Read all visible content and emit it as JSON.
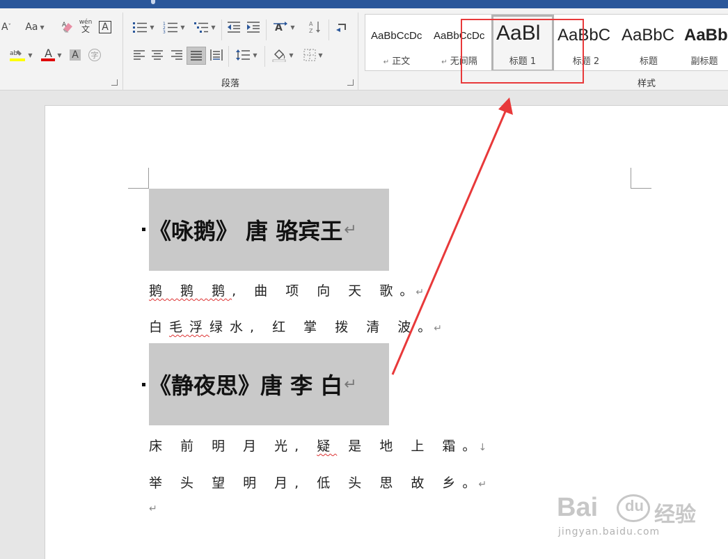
{
  "ribbon": {
    "font_group": {
      "font_shrink_label": "A",
      "change_case_label": "Aa",
      "phonetic_label": "wén\n文",
      "char_border_label": "A",
      "font_color_label": "A",
      "char_shading_label": "A",
      "enclose_char_label": "字",
      "highlight_color": "#ffff00",
      "font_color": "#e00000"
    },
    "paragraph_group": {
      "label": "段落"
    },
    "styles_group": {
      "label": "样式",
      "items": [
        {
          "preview": "AaBbCcDc",
          "name": "正文",
          "mark": "↵"
        },
        {
          "preview": "AaBbCcDc",
          "name": "无间隔",
          "mark": "↵"
        },
        {
          "preview": "AaBl",
          "name": "标题 1"
        },
        {
          "preview": "AaBbC",
          "name": "标题 2"
        },
        {
          "preview": "AaBbC",
          "name": "标题"
        },
        {
          "preview": "AaBb",
          "name": "副标题"
        }
      ]
    }
  },
  "document": {
    "heading1": "《咏鹅》 唐 骆宾王",
    "poem1_line1_prefix": "鹅 鹅 鹅",
    "poem1_line1_rest": ", 曲 项 向 天 歌。",
    "poem1_line2_prefix": "白",
    "poem1_line2_squig": "毛浮",
    "poem1_line2_rest": "绿水, 红 掌 拨 清 波。",
    "heading2": "《静夜思》唐 李 白",
    "poem2_line1_prefix": "床 前 明 月 光, ",
    "poem2_line1_squig": "疑",
    "poem2_line1_rest": " 是 地 上 霜。",
    "poem2_line2": "举 头 望 明 月, 低 头 思 故 乡。",
    "para_mark": "↵",
    "line_break_mark": "↓"
  },
  "watermark": {
    "brand": "Bai",
    "brand2": "du",
    "product": "经验",
    "url": "jingyan.baidu.com"
  },
  "colors": {
    "title_bar": "#2b579a",
    "annotation_red": "#e8393a",
    "heading_shading": "#c9c9c9"
  }
}
